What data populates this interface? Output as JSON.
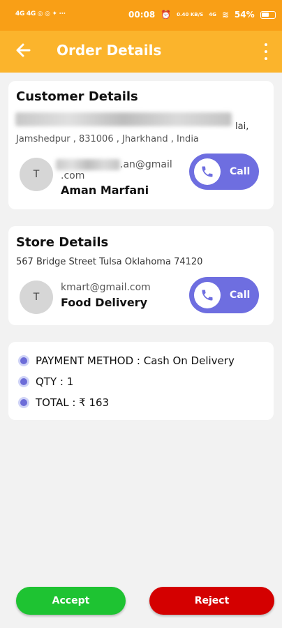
{
  "status_bar": {
    "left_text": "4G 4G ◎ ◎ ✦ ⋯",
    "time": "00:08",
    "speed": "0.40 KB/S",
    "network": "4G",
    "battery": "54%"
  },
  "app_bar": {
    "title": "Order Details"
  },
  "customer": {
    "section_title": "Customer Details",
    "address_line1_visible": "lai,",
    "address_line2": "Jamshedpur , 831006 , Jharkhand , India",
    "avatar_initial": "T",
    "email_line1": ".an@gmail",
    "email_line2": ".com",
    "name": "Aman Marfani",
    "call_label": "Call"
  },
  "store": {
    "section_title": "Store Details",
    "address": "567  Bridge Street Tulsa Oklahoma 74120",
    "avatar_initial": "T",
    "email": "kmart@gmail.com",
    "name": "Food Delivery",
    "call_label": "Call"
  },
  "summary": {
    "payment": "PAYMENT METHOD : Cash On Delivery",
    "qty": "QTY : 1",
    "total": "TOTAL : ₹ 163"
  },
  "actions": {
    "accept_label": "Accept",
    "reject_label": "Reject"
  },
  "colors": {
    "status_bar": "#f99f16",
    "app_bar": "#fbb42c",
    "call_button": "#6e6ee0",
    "accept": "#1ec332",
    "reject": "#d40000"
  }
}
